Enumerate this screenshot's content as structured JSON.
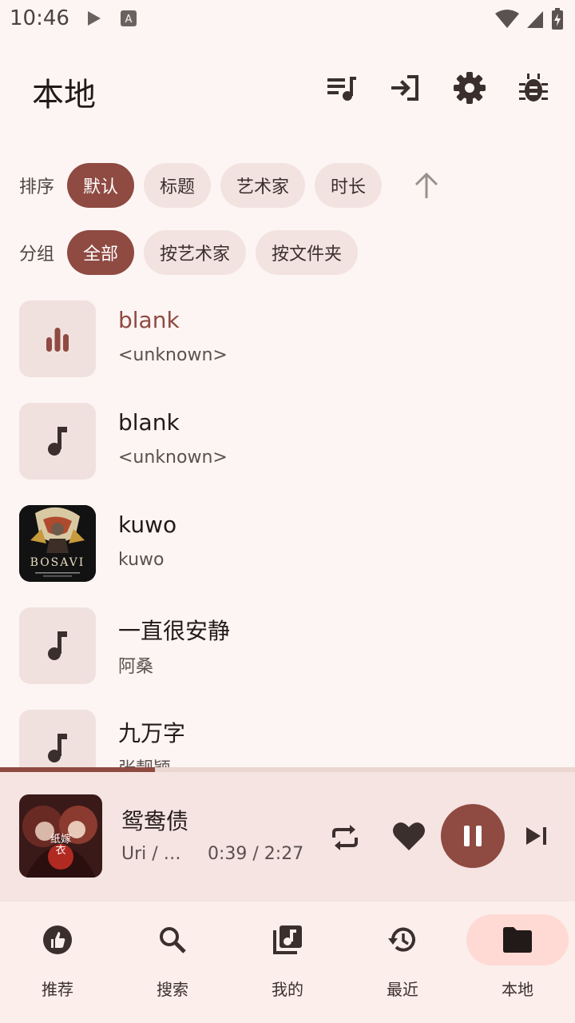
{
  "status_bar": {
    "time": "10:46"
  },
  "header": {
    "title": "本地",
    "actions": [
      "playlist-icon",
      "login-icon",
      "settings-icon",
      "bug-icon"
    ]
  },
  "sort": {
    "label": "排序",
    "options": [
      "默认",
      "标题",
      "艺术家",
      "时长"
    ],
    "selected": "默认",
    "direction": "ascending"
  },
  "group": {
    "label": "分组",
    "options": [
      "全部",
      "按艺术家",
      "按文件夹"
    ],
    "selected": "全部"
  },
  "songs": [
    {
      "title": "blank",
      "artist": "<unknown>",
      "playing": true,
      "thumb": "equalizer-icon"
    },
    {
      "title": "blank",
      "artist": "<unknown>",
      "thumb": "music-note-icon"
    },
    {
      "title": "kuwo",
      "artist": "kuwo",
      "thumb": "album-art",
      "art_text": "BOSAVI"
    },
    {
      "title": "一直很安静",
      "artist": "阿桑",
      "thumb": "music-note-icon"
    },
    {
      "title": "九万字",
      "artist": "张靓颖",
      "thumb": "music-note-icon"
    }
  ],
  "now_playing": {
    "title": "鸳鸯债",
    "artist": "Uri / …",
    "time": "0:39 / 2:27",
    "progress": 0.27,
    "cover_text": "纸嫁衣"
  },
  "nav": {
    "items": [
      {
        "label": "推荐",
        "icon": "thumb-up-icon"
      },
      {
        "label": "搜索",
        "icon": "search-icon"
      },
      {
        "label": "我的",
        "icon": "library-music-icon"
      },
      {
        "label": "最近",
        "icon": "history-icon"
      },
      {
        "label": "本地",
        "icon": "folder-icon",
        "active": true
      }
    ]
  },
  "colors": {
    "accent": "#8f4a42",
    "background": "#fdf5f3",
    "chip": "#f2e3e0",
    "active_nav": "#ffdad4"
  }
}
